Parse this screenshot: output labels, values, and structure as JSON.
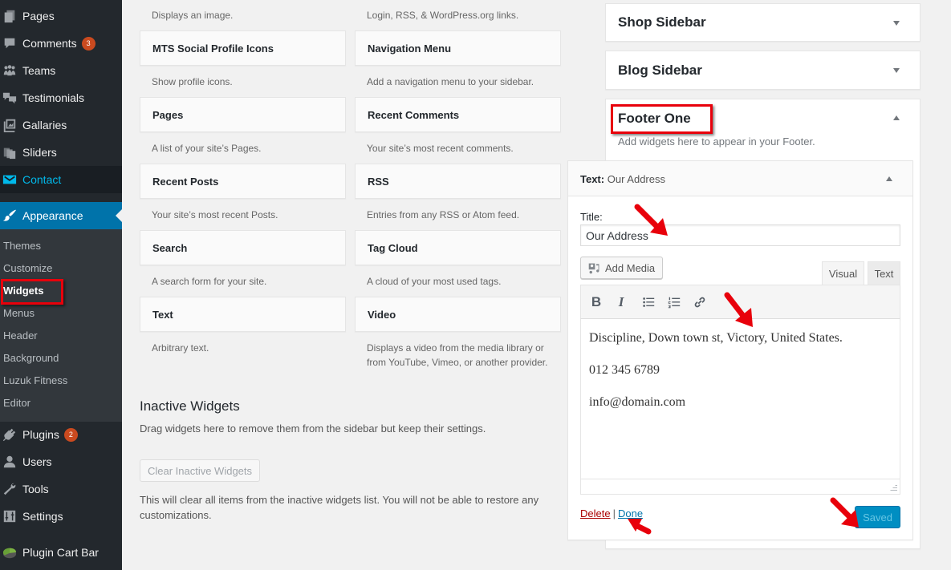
{
  "sidebar": {
    "items": [
      {
        "label": "Pages",
        "icon": "pages-icon"
      },
      {
        "label": "Comments",
        "icon": "comments-icon",
        "badge": "3"
      },
      {
        "label": "Teams",
        "icon": "teams-icon"
      },
      {
        "label": "Testimonials",
        "icon": "testimonials-icon"
      },
      {
        "label": "Gallaries",
        "icon": "gallery-icon"
      },
      {
        "label": "Sliders",
        "icon": "sliders-icon"
      },
      {
        "label": "Contact",
        "icon": "envelope-icon"
      },
      {
        "label": "Appearance",
        "icon": "paintbrush-icon"
      },
      {
        "label": "Plugins",
        "icon": "plug-icon",
        "badge": "2"
      },
      {
        "label": "Users",
        "icon": "user-icon"
      },
      {
        "label": "Tools",
        "icon": "wrench-icon"
      },
      {
        "label": "Settings",
        "icon": "settings-icon"
      },
      {
        "label": "Plugin Cart Bar",
        "icon": "pie-chart-icon"
      }
    ],
    "appearance_submenu": [
      {
        "label": "Themes"
      },
      {
        "label": "Customize"
      },
      {
        "label": "Widgets",
        "current": true
      },
      {
        "label": "Menus"
      },
      {
        "label": "Header"
      },
      {
        "label": "Background"
      },
      {
        "label": "Luzuk Fitness"
      },
      {
        "label": "Editor"
      }
    ],
    "colors": {
      "bg": "#23282d",
      "active": "#0073aa",
      "badge": "#ca4a1f",
      "contact": "#00b9eb"
    }
  },
  "available_widgets": {
    "top_descriptions": [
      "Displays an image.",
      "Login, RSS, & WordPress.org links."
    ],
    "widgets": [
      {
        "name": "MTS Social Profile Icons",
        "description": "Show profile icons."
      },
      {
        "name": "Navigation Menu",
        "description": "Add a navigation menu to your sidebar."
      },
      {
        "name": "Pages",
        "description": "A list of your site’s Pages."
      },
      {
        "name": "Recent Comments",
        "description": "Your site’s most recent comments."
      },
      {
        "name": "Recent Posts",
        "description": "Your site’s most recent Posts."
      },
      {
        "name": "RSS",
        "description": "Entries from any RSS or Atom feed."
      },
      {
        "name": "Search",
        "description": "A search form for your site."
      },
      {
        "name": "Tag Cloud",
        "description": "A cloud of your most used tags."
      },
      {
        "name": "Text",
        "description": "Arbitrary text."
      },
      {
        "name": "Video",
        "description": "Displays a video from the media library or from YouTube, Vimeo, or another provider."
      }
    ]
  },
  "inactive": {
    "title": "Inactive Widgets",
    "description": "Drag widgets here to remove them from the sidebar but keep their settings.",
    "clear_button": "Clear Inactive Widgets",
    "note": "This will clear all items from the inactive widgets list. You will not be able to restore any customizations."
  },
  "sidebar_areas": [
    {
      "title": "Shop Sidebar",
      "expanded": false
    },
    {
      "title": "Blog Sidebar",
      "expanded": false
    },
    {
      "title": "Footer One",
      "expanded": true,
      "description": "Add widgets here to appear in your Footer."
    }
  ],
  "open_widget": {
    "type_label": "Text:",
    "instance_title": "Our Address",
    "title_label": "Title:",
    "title_value": "Our Address",
    "add_media": "Add Media",
    "tabs": {
      "visual": "Visual",
      "text": "Text"
    },
    "toolbar": [
      "bold-icon",
      "italic-icon",
      "bulleted-list-icon",
      "numbered-list-icon",
      "link-icon"
    ],
    "toolbar_labels": {
      "bold": "B",
      "italic": "I"
    },
    "content": [
      "Discipline, Down town st, Victory, United States.",
      "012 345 6789",
      "info@domain.com"
    ],
    "delete_link": "Delete",
    "separator": "|",
    "done_link": "Done",
    "save_button": "Saved",
    "colors": {
      "save_bg": "#008ec2",
      "delete": "#aa0000",
      "done": "#0073aa"
    }
  },
  "annotations": {
    "highlight_color": "#e8000b",
    "arrow_color": "#e8000b"
  }
}
